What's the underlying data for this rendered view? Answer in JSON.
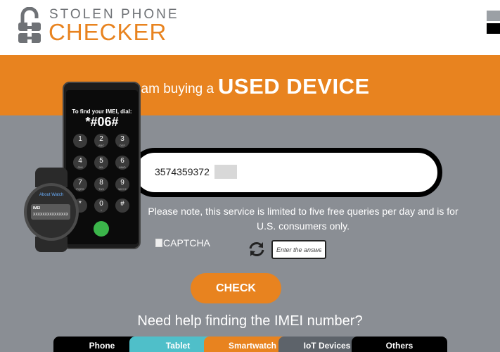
{
  "header": {
    "logo_top": "STOLEN PHONE",
    "logo_bottom": "CHECKER"
  },
  "banner": {
    "prefix": "I am buying a",
    "emphasis": "USED DEVICE"
  },
  "phone_illustration": {
    "instruction": "To find your IMEI, dial:",
    "code": "*#06#",
    "keys": [
      {
        "d": "1",
        "s": ""
      },
      {
        "d": "2",
        "s": "ABC"
      },
      {
        "d": "3",
        "s": "DEF"
      },
      {
        "d": "4",
        "s": "GHI"
      },
      {
        "d": "5",
        "s": "JKL"
      },
      {
        "d": "6",
        "s": "MNO"
      },
      {
        "d": "7",
        "s": "PQRS"
      },
      {
        "d": "8",
        "s": "TUV"
      },
      {
        "d": "9",
        "s": "WXYZ"
      },
      {
        "d": "*",
        "s": ""
      },
      {
        "d": "0",
        "s": "+"
      },
      {
        "d": "#",
        "s": ""
      }
    ]
  },
  "watch_illustration": {
    "title": "About Watch",
    "imei_label": "IMEI",
    "imei_value": "XXXXXXXXXXXXXXX"
  },
  "form": {
    "imei_value": "3574359372",
    "notice": "Please note, this service is limited to five free queries per day and is for U.S. consumers only.",
    "captcha_alt": "CAPTCHA",
    "captcha_placeholder": "Enter the answer",
    "check_label": "CHECK"
  },
  "help_text": "Need help finding the IMEI number?",
  "tabs": [
    {
      "label": "Phone",
      "color": "#000000"
    },
    {
      "label": "Tablet",
      "color": "#4fbfc9"
    },
    {
      "label": "Smartwatch",
      "color": "#e8831f"
    },
    {
      "label": "IoT Devices",
      "color": "#5d636a"
    },
    {
      "label": "Others",
      "color": "#000000"
    }
  ],
  "colors": {
    "brand_orange": "#e8831f",
    "brand_gray": "#6f7276",
    "background": "#8a8e94"
  }
}
